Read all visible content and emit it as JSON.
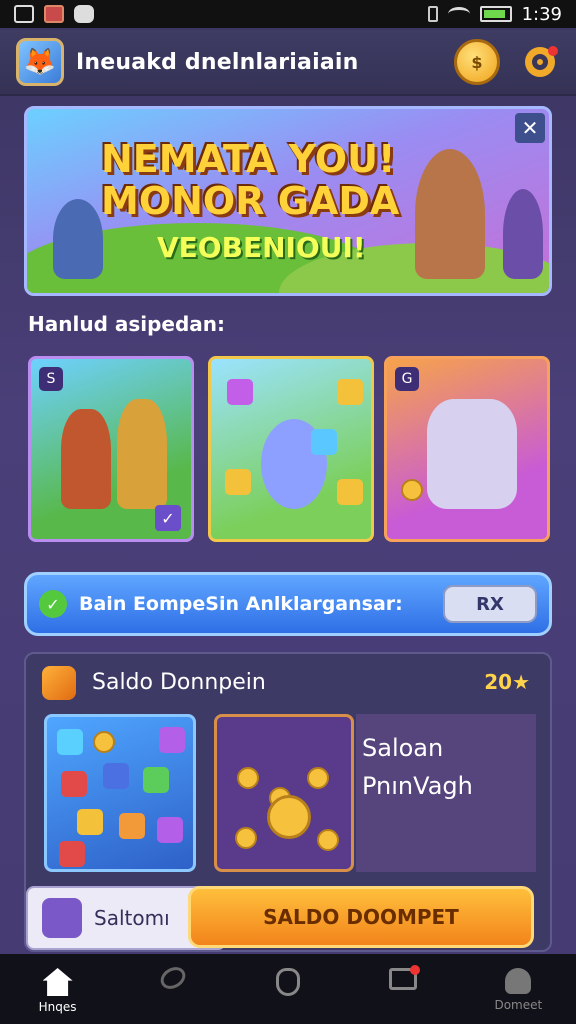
{
  "status_bar": {
    "time": "1:39",
    "battery_level": 0.9
  },
  "header": {
    "title": "Ineuakd dnelnlariaiain"
  },
  "hero": {
    "line1": "NEMATA YOU!",
    "line2": "MONOR GADA",
    "line3": "VEOBENIOUI!",
    "close_label": "✕"
  },
  "section": {
    "title": "Hanlud asipedan:"
  },
  "cards": [
    {
      "badge": "S",
      "check": "✓"
    },
    {
      "badge": "",
      "check": ""
    },
    {
      "badge": "G",
      "check": ""
    }
  ],
  "promo": {
    "text": "Bain EompeSin Anlklargansar:",
    "pill": "RX",
    "check": "✓"
  },
  "panel": {
    "title": "Saldo Donnpein",
    "score": "20★",
    "tile_text1": "Saloan",
    "tile_text2": "PnınVagh"
  },
  "bottom": {
    "card_text": "Saltomı",
    "cta": "SALDO DOOMPET"
  },
  "tabbar": {
    "items": [
      {
        "label": "Hnqes"
      },
      {
        "label": ""
      },
      {
        "label": ""
      },
      {
        "label": ""
      },
      {
        "label": "Domeet"
      }
    ]
  }
}
